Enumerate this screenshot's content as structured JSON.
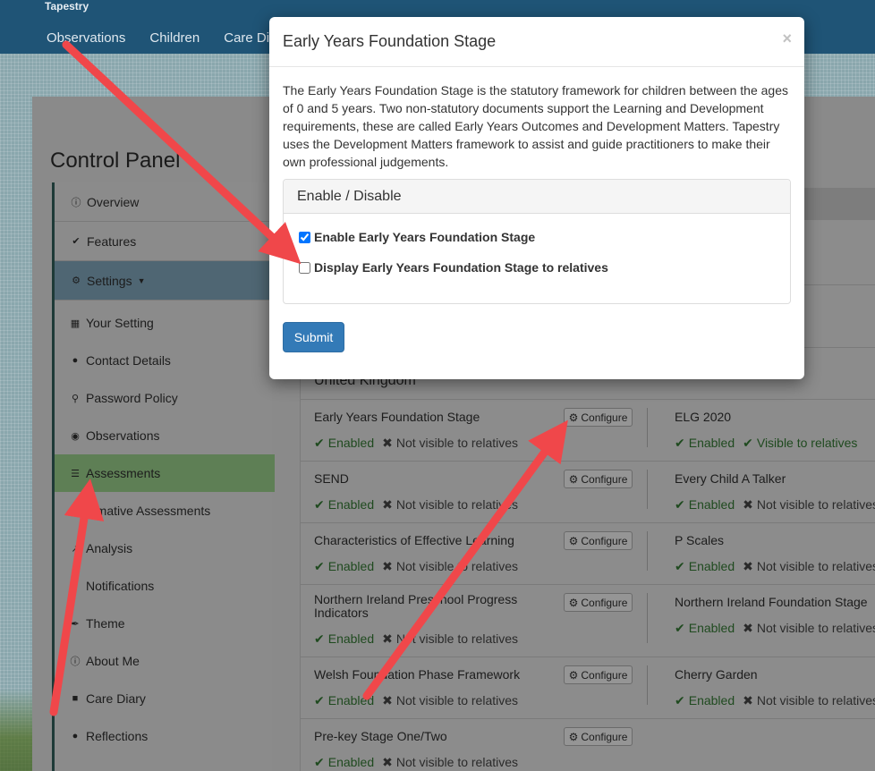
{
  "app": {
    "brand": "Tapestry"
  },
  "nav": {
    "items": [
      "Observations",
      "Children",
      "Care Diary"
    ]
  },
  "control_panel": {
    "title": "Control Panel"
  },
  "sidebar": {
    "items": [
      {
        "label": "Overview",
        "icon": "info-icon"
      },
      {
        "label": "Features",
        "icon": "check-icon"
      },
      {
        "label": "Settings",
        "icon": "gear-icon"
      },
      {
        "label": "Your Setting",
        "icon": "building-icon"
      },
      {
        "label": "Contact Details",
        "icon": "chat-icon"
      },
      {
        "label": "Password Policy",
        "icon": "key-icon"
      },
      {
        "label": "Observations",
        "icon": "eye-icon"
      },
      {
        "label": "Assessments",
        "icon": "list-icon"
      },
      {
        "label": "mmative Assessments",
        "icon": "grid-icon"
      },
      {
        "label": "Analysis",
        "icon": "chart-icon"
      },
      {
        "label": "Notifications",
        "icon": "bell-icon"
      },
      {
        "label": "Theme",
        "icon": "brush-icon"
      },
      {
        "label": "About Me",
        "icon": "info-icon"
      },
      {
        "label": "Care Diary",
        "icon": "book-icon"
      },
      {
        "label": "Reflections",
        "icon": "comment-icon"
      }
    ]
  },
  "frameworks": {
    "region": "United Kingdom",
    "configure_label": "Configure",
    "enabled_label": "Enabled",
    "not_visible_label": "Not visible to relatives",
    "visible_label": "Visible to relatives",
    "left": [
      {
        "name": "Early Years Foundation Stage",
        "enabled": "Enabled",
        "visibility": "Not visible to relatives"
      },
      {
        "name": "SEND",
        "enabled": "Enabled",
        "visibility": "Not visible to relatives"
      },
      {
        "name": "Characteristics of Effective Learning",
        "enabled": "Enabled",
        "visibility": "Not visible to relatives"
      },
      {
        "name": "Northern Ireland Preschool Progress\nIndicators",
        "enabled": "Enabled",
        "visibility": "Not visible to relatives"
      },
      {
        "name": "Welsh Foundation Phase Framework",
        "enabled": "Enabled",
        "visibility": "Not visible to relatives"
      },
      {
        "name": "Pre-key Stage One/Two",
        "enabled": "Enabled",
        "visibility": "Not visible to relatives"
      }
    ],
    "right": [
      {
        "name": "ELG 2020",
        "enabled": "Enabled",
        "visibility": "Visible to relatives"
      },
      {
        "name": "Every Child A Talker",
        "enabled": "Enabled",
        "visibility": "Not visible to relatives"
      },
      {
        "name": "P Scales",
        "enabled": "Enabled",
        "visibility": "Not visible to relatives"
      },
      {
        "name": "Northern Ireland Foundation Stage",
        "enabled": "Enabled",
        "visibility": "Not visible to relatives"
      },
      {
        "name": "Cherry Garden",
        "enabled": "Enabled",
        "visibility": "Not visible to relatives"
      }
    ]
  },
  "modal": {
    "title": "Early Years Foundation Stage",
    "close": "×",
    "description": "The Early Years Foundation Stage is the statutory framework for children between the ages of 0 and 5 years. Two non-statutory documents support the Learning and Development requirements, these are called Early Years Outcomes and Development Matters. Tapestry uses the Development Matters framework to assist and guide practitioners to make their own professional judgements.",
    "panel_title": "Enable / Disable",
    "checkbox_enable": {
      "label": "Enable Early Years Foundation Stage",
      "checked": true
    },
    "checkbox_relatives": {
      "label": "Display Early Years Foundation Stage to relatives",
      "checked": false
    },
    "submit": "Submit"
  },
  "colors": {
    "nav_bg": "#1f5476",
    "primary_button": "#337ab7",
    "annotation_arrow": "#f0474a"
  }
}
